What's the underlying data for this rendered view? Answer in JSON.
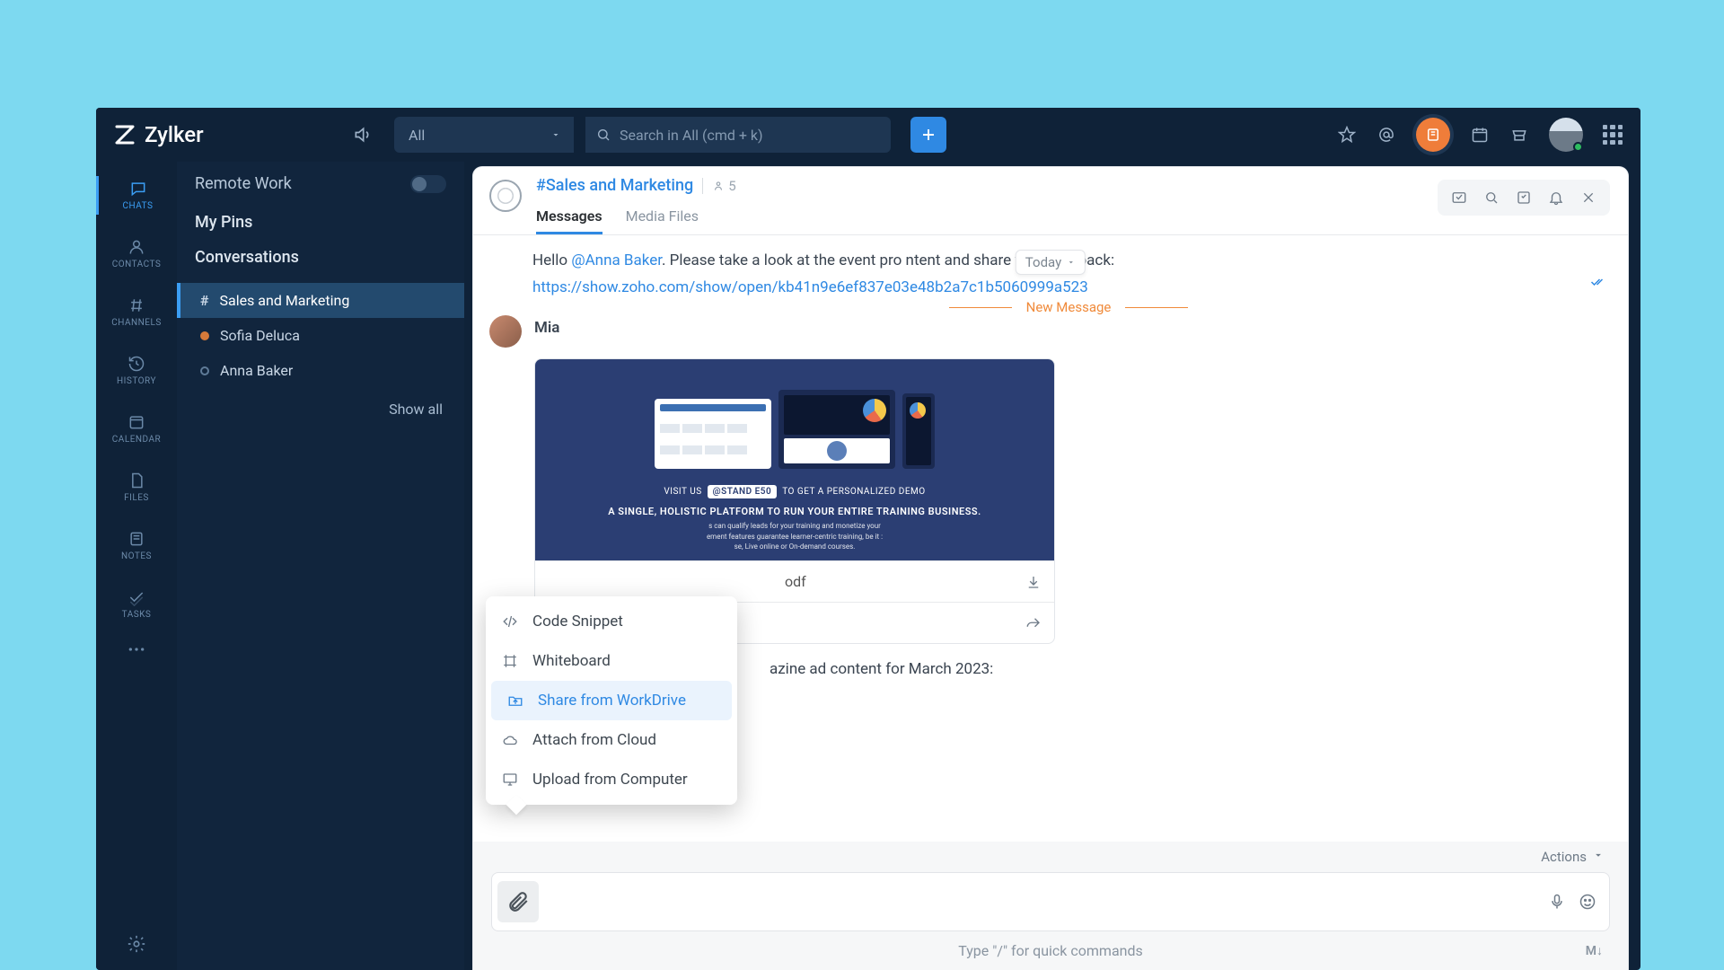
{
  "brand": "Zylker",
  "topbar": {
    "filter_label": "All",
    "search_placeholder": "Search in All (cmd + k)"
  },
  "sidebar": {
    "header": "Remote Work",
    "my_pins": "My Pins",
    "conversations_title": "Conversations",
    "show_all": "Show all",
    "items": [
      {
        "label": "Sales and Marketing"
      },
      {
        "label": "Sofia Deluca"
      },
      {
        "label": "Anna Baker"
      }
    ]
  },
  "rail": {
    "items": [
      "CHATS",
      "CONTACTS",
      "CHANNELS",
      "HISTORY",
      "CALENDAR",
      "FILES",
      "NOTES",
      "TASKS"
    ]
  },
  "chat": {
    "channel_name": "#Sales and Marketing",
    "member_count": "5",
    "tabs": {
      "messages": "Messages",
      "media": "Media Files"
    },
    "today_label": "Today",
    "greeting_prefix": "Hello ",
    "mention": "@Anna Baker",
    "greeting_suffix": ". Please take a look at the event pro           ntent and share your feedback:",
    "link": "https://show.zoho.com/show/open/kb41n9e6ef837e03e48b2a7c1b5060999a523",
    "new_message_label": "New Message",
    "sender": "Mia",
    "attachment": {
      "visit_text": "VISIT US",
      "stand": "@STAND E50",
      "visit_suffix": "TO GET A PERSONALIZED DEMO",
      "headline": "A SINGLE, HOLISTIC PLATFORM TO RUN YOUR ENTIRE TRAINING BUSINESS.",
      "subtext": "s can qualify leads for your training and monetize your\nement features guarantee learner-centric training, be it :\nse, Live online or On-demand courses.",
      "file_ext": "odf"
    },
    "caption_suffix": "azine ad content for March 2023:",
    "actions_label": "Actions",
    "quick_hint": "Type \"/\" for quick commands",
    "md_label": "M↓"
  },
  "attach_menu": {
    "items": [
      "Code Snippet",
      "Whiteboard",
      "Share from WorkDrive",
      "Attach from Cloud",
      "Upload from Computer"
    ]
  }
}
